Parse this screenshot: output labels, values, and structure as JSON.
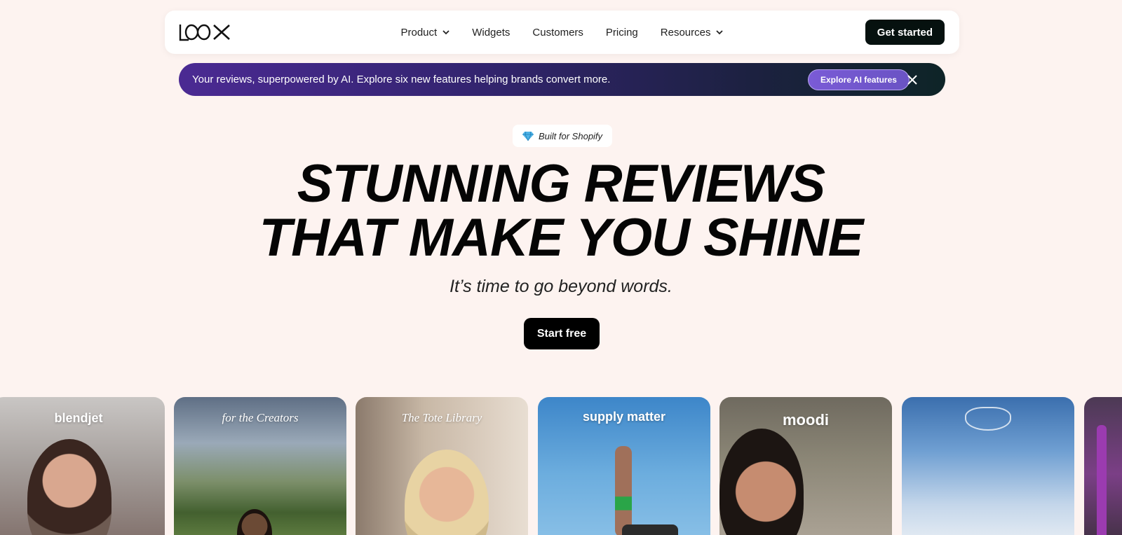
{
  "nav": {
    "logo": "LOOX",
    "links": [
      {
        "label": "Product",
        "dropdown": true
      },
      {
        "label": "Widgets",
        "dropdown": false
      },
      {
        "label": "Customers",
        "dropdown": false
      },
      {
        "label": "Pricing",
        "dropdown": false
      },
      {
        "label": "Resources",
        "dropdown": true
      }
    ],
    "cta": "Get started"
  },
  "banner": {
    "text": "Your reviews, superpowered by AI. Explore six new features helping brands convert more.",
    "button": "Explore AI features"
  },
  "hero": {
    "badge": "Built for Shopify",
    "headline_line1": "STUNNING REVIEWS",
    "headline_line2": "THAT MAKE YOU SHINE",
    "subheadline": "It’s time to go beyond words.",
    "cta": "Start free"
  },
  "carousel": {
    "cards": [
      {
        "brand": "blendjet"
      },
      {
        "brand": "for the Creators"
      },
      {
        "brand": "The Tote Library"
      },
      {
        "brand": "supply matter"
      },
      {
        "brand": "moodi"
      },
      {
        "brand": ""
      },
      {
        "brand": ""
      }
    ]
  },
  "colors": {
    "background": "#fdf3f0",
    "primary_button": "#06110f",
    "banner_start": "#4b2a93",
    "banner_end": "#0e2427",
    "banner_button": "#7a5bd6"
  }
}
